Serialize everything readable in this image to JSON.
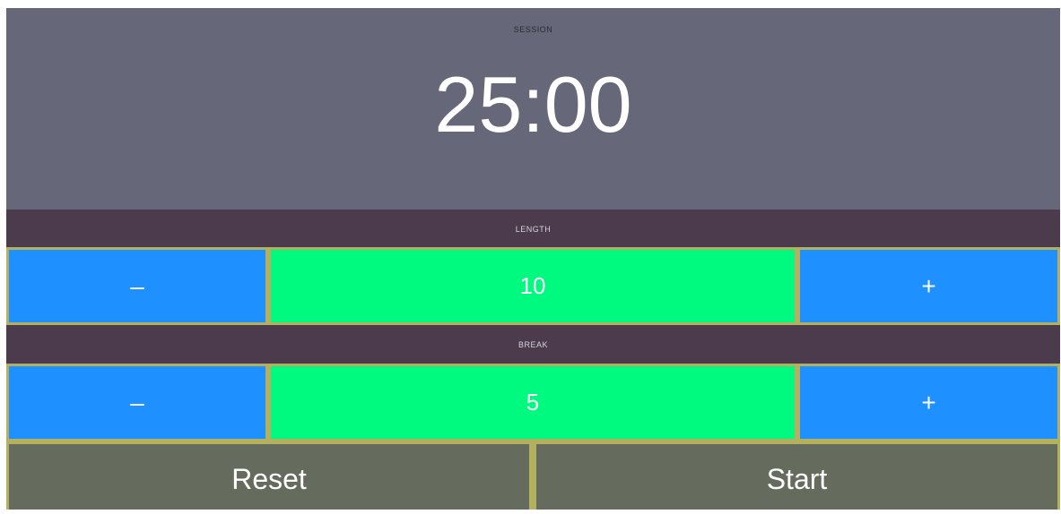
{
  "session": {
    "label": "SESSION",
    "time": "25:00"
  },
  "length": {
    "label": "LENGTH",
    "decrement": "–",
    "value": "10",
    "increment": "+"
  },
  "break": {
    "label": "BREAK",
    "decrement": "–",
    "value": "5",
    "increment": "+"
  },
  "controls": {
    "reset_label": "Reset",
    "start_label": "Start"
  },
  "colors": {
    "session_bg": "#67677a",
    "header_bg": "#4b3b4c",
    "button_blue": "#1e90ff",
    "value_green": "#00fa7f",
    "control_gray": "#656b5d",
    "border_olive": "#b3b160"
  }
}
